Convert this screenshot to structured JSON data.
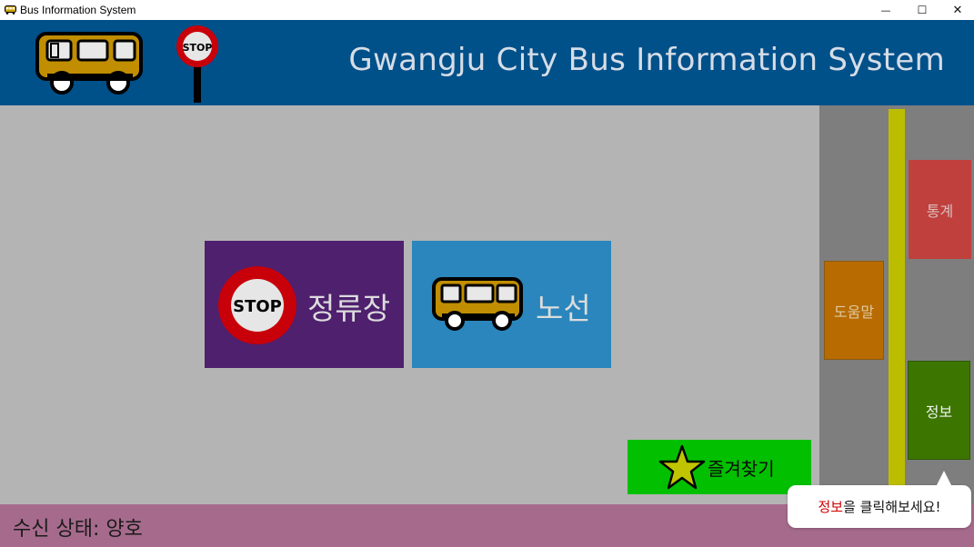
{
  "window": {
    "title": "Bus Information System",
    "controls": {
      "minimize": "—",
      "maximize": "☐",
      "close": "✕"
    }
  },
  "header": {
    "title": "Gwangju City Bus Information System",
    "stop_sign_text": "STOP",
    "icons": [
      "bus-icon",
      "bus-stop-sign-icon"
    ]
  },
  "tiles": {
    "stop": {
      "label": "정류장",
      "icon_text": "STOP",
      "icon": "stop-sign-icon"
    },
    "route": {
      "label": "노선",
      "icon": "bus-icon"
    }
  },
  "favorites": {
    "label": "즐겨찾기",
    "icon": "star-icon"
  },
  "side": {
    "stats_label": "통계",
    "help_label": "도움말",
    "info_label": "정보"
  },
  "status": {
    "text": "수신 상태: 양호"
  },
  "tooltip": {
    "highlight": "정보",
    "rest": "을 클릭해보세요!"
  },
  "colors": {
    "header": "#00508a",
    "stop_tile": "#4e206e",
    "route_tile": "#2a86bc",
    "favorites": "#02c000",
    "stats": "#c0403d",
    "help": "#b76b00",
    "info": "#3c7500",
    "statusbar": "#a66b8c",
    "lane": "#bdbd00"
  }
}
